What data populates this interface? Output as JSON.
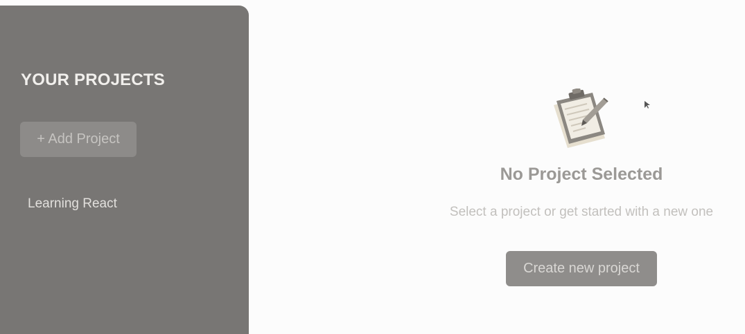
{
  "sidebar": {
    "title": "YOUR PROJECTS",
    "add_button_label": "+ Add Project",
    "projects": [
      {
        "label": "Learning React"
      }
    ]
  },
  "main": {
    "illustration_icon": "clipboard-with-pen-icon",
    "empty_title": "No Project Selected",
    "empty_subtitle": "Select a project or get started with a new one",
    "create_button_label": "Create new project"
  },
  "colors": {
    "sidebar_bg": "#787674",
    "page_bg": "#fcfcfc",
    "button_bg": "#8f8d8b"
  }
}
